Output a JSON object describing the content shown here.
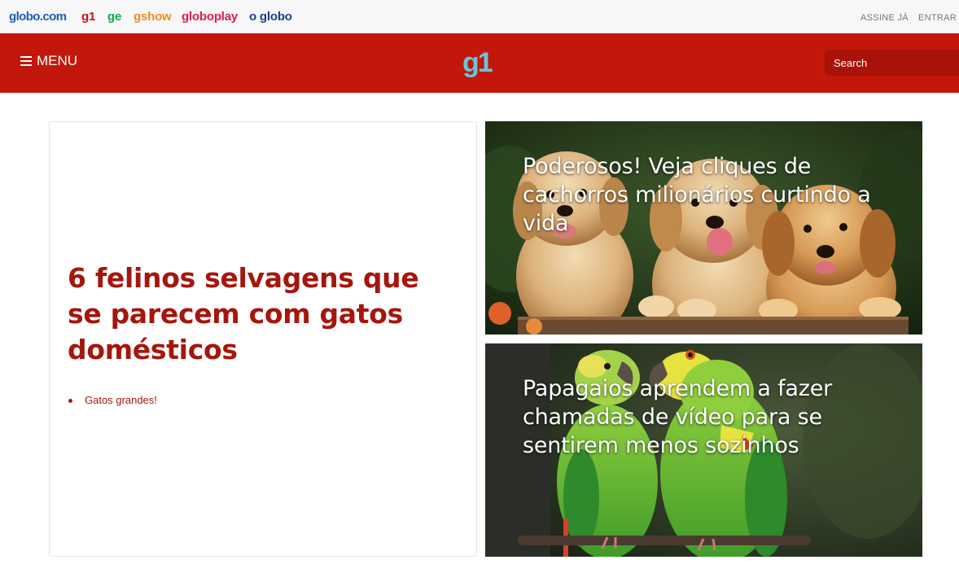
{
  "topbar": {
    "brands": [
      "globo.com",
      "g1",
      "ge",
      "gshow",
      "globoplay",
      "o globo"
    ],
    "assine": "ASSINE JÁ",
    "entrar": "ENTRAR"
  },
  "header": {
    "menu_label": "MENU",
    "logo": "g1",
    "search_placeholder": "Search"
  },
  "main_story": {
    "title": "6 felinos selvagens que se parecem com gatos domésticos",
    "related": [
      "Gatos grandes!"
    ]
  },
  "features": [
    {
      "title": "Poderosos! Veja cliques de cachorros milionários curtindo a vida",
      "image": "golden retriever puppies photo"
    },
    {
      "title": "Papagaios aprendem a fazer chamadas de vídeo para se sentirem menos sozinhos",
      "image": "green parrots photo"
    }
  ],
  "colors": {
    "brand_red": "#c4170c",
    "title_red": "#a5160d",
    "g1_logo": "#64c8d8"
  }
}
